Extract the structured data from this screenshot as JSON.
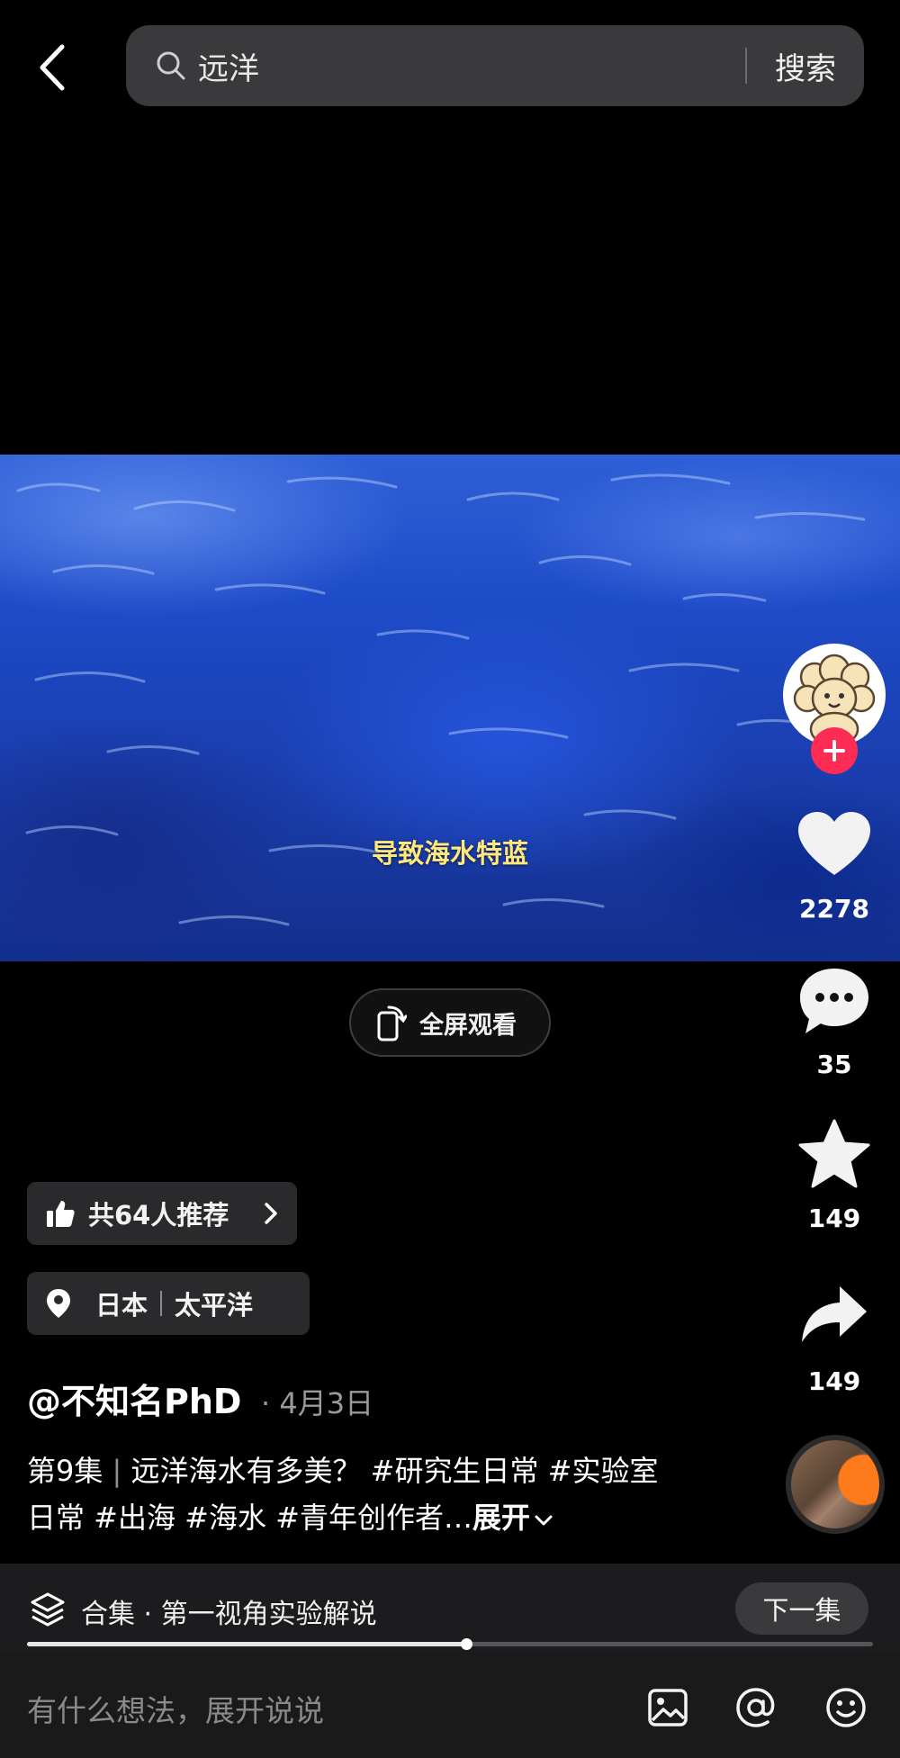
{
  "search": {
    "query": "远洋",
    "button_label": "搜索"
  },
  "video": {
    "subtitle": "导致海水特蓝"
  },
  "fullscreen": {
    "label": "全屏观看"
  },
  "side_actions": {
    "likes": "2278",
    "comments": "35",
    "favorites": "149",
    "shares": "149"
  },
  "recommend": {
    "label": "共64人推荐"
  },
  "location": {
    "country": "日本",
    "place": "太平洋"
  },
  "post": {
    "author": "@不知名PhD",
    "date": "· 4月3日",
    "caption_episode": "第9集",
    "caption_sep": "|",
    "caption_text": "远洋海水有多美？ #研究生日常 #实验室日常 #出海 #海水 #青年创作者…",
    "expand_label": "展开"
  },
  "collection": {
    "label": "合集 · 第一视角实验解说",
    "next_label": "下一集",
    "progress": 0.52
  },
  "comment": {
    "placeholder": "有什么想法，展开说说"
  },
  "icons": [
    "back-icon",
    "search-icon",
    "rotate-screen-icon",
    "plus-icon",
    "heart-icon",
    "comment-bubble-icon",
    "star-icon",
    "share-arrow-icon",
    "thumbs-up-icon",
    "chevron-right-icon",
    "location-pin-icon",
    "chevron-down-icon",
    "stack-icon",
    "image-icon",
    "at-icon",
    "emoji-icon"
  ],
  "colors": {
    "accent": "#fe2c55",
    "subtitle": "#ffe97a",
    "background": "#000000",
    "ocean": "#1e4bc8"
  }
}
